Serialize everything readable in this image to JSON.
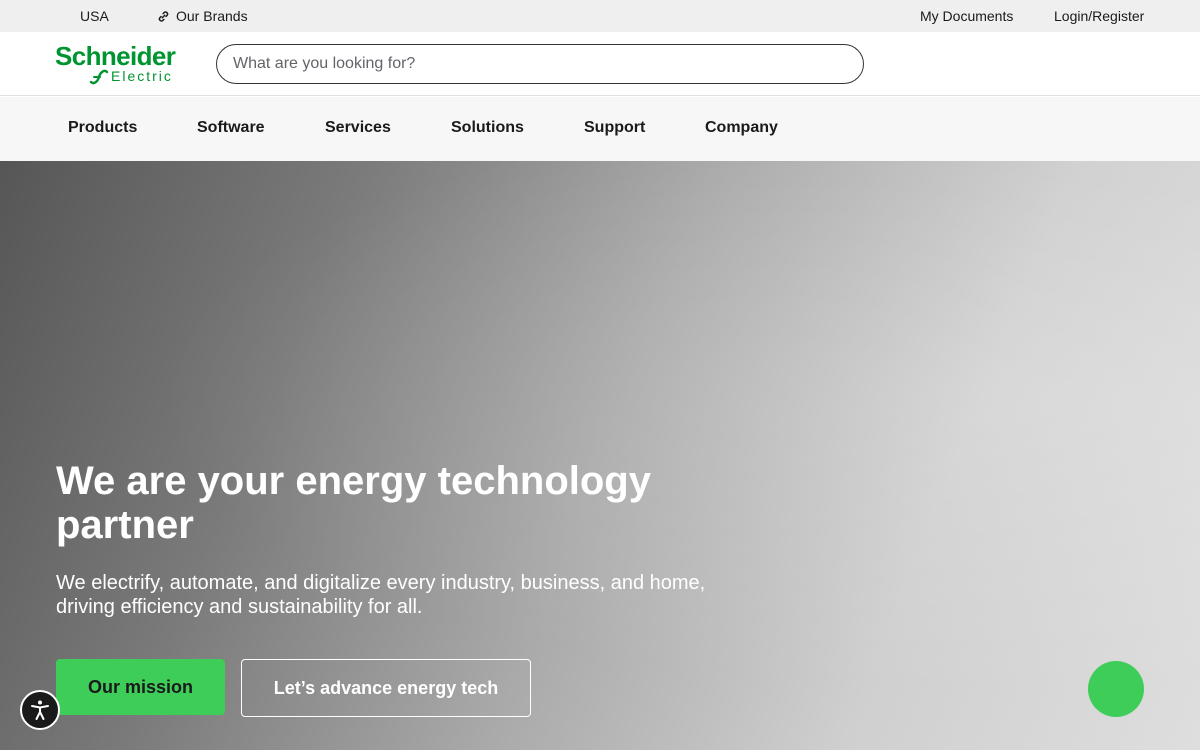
{
  "utility_bar": {
    "region": "USA",
    "brands": "Our Brands",
    "documents": "My Documents",
    "login": "Login/Register"
  },
  "header": {
    "logo_line1": "Schneider",
    "logo_line2": "Electric",
    "search_placeholder": "What are you looking for?",
    "brand_color": "#009530"
  },
  "nav": {
    "items": [
      "Products",
      "Software",
      "Services",
      "Solutions",
      "Support",
      "Company"
    ]
  },
  "hero": {
    "title": "We are your energy technology partner",
    "subtitle": "We electrify, automate, and digitalize every industry, business, and home, driving efficiency and sustainability for all.",
    "primary_cta": "Our mission",
    "secondary_cta": "Let’s advance energy tech",
    "accent_color": "#3dcd58"
  },
  "icons": {
    "brands": "link-icon",
    "accessibility": "accessibility-icon",
    "chat": "chat-icon"
  }
}
